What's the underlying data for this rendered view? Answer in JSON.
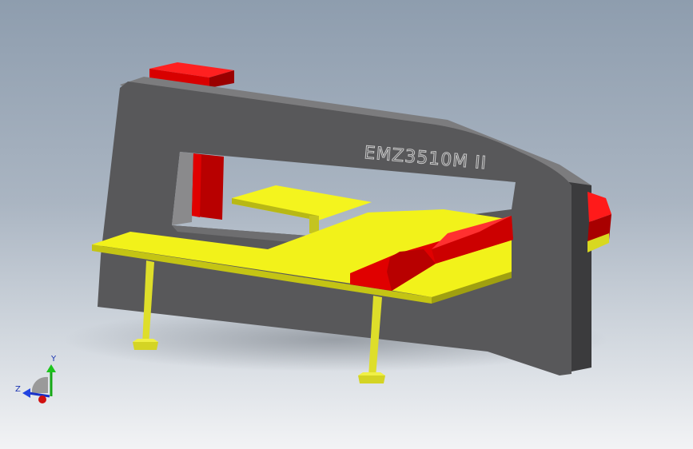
{
  "model": {
    "engraving": "EMZ3510M II"
  },
  "triad": {
    "y_label": "Y",
    "z_label": "Z"
  },
  "colors": {
    "frame": "#5a5a5c",
    "frame_top": "#7a7a7c",
    "frame_side": "#3e3e40",
    "table": "#f2f21a",
    "table_edge": "#b5b512",
    "accent_red": "#e00000",
    "accent_red_dark": "#8e0000",
    "leg": "#d8d830"
  }
}
